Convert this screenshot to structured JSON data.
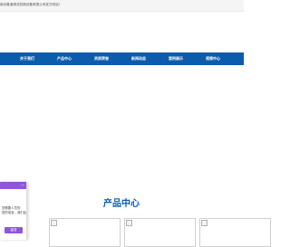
{
  "topbar": {
    "welcome_text": "南京管道清洗机械设备有限公司官方网站！"
  },
  "nav": {
    "items": [
      "关于我们",
      "产品中心",
      "资质荣誉",
      "新闻动态",
      "案例展示",
      "视频中心"
    ]
  },
  "products": {
    "title": "产品中心"
  },
  "chat": {
    "minimize": "—",
    "line1": "您需要人员的",
    "line2": "您的信息，我们会",
    "button_label": "留言"
  },
  "colors": {
    "brand_blue": "#0b5cad",
    "chat_purple": "#8e57d9"
  }
}
